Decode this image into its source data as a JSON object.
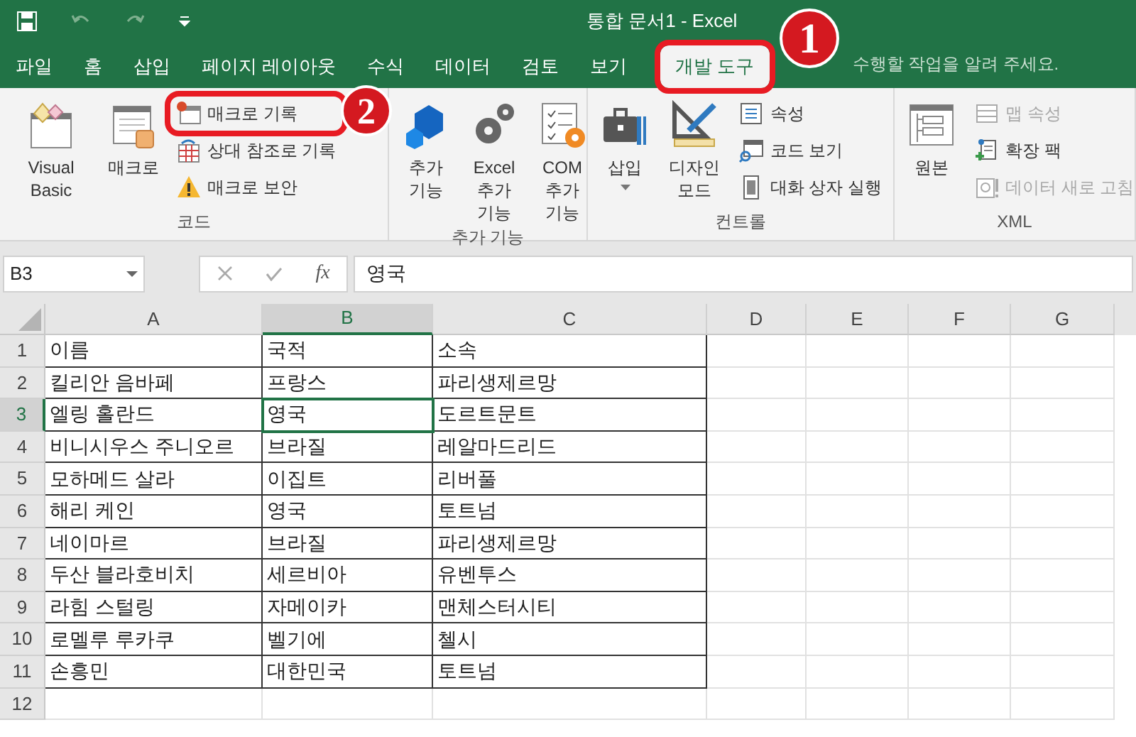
{
  "window": {
    "title": "통합 문서1 - Excel"
  },
  "tabs": [
    {
      "label": "파일",
      "selected": false,
      "highlighted": false
    },
    {
      "label": "홈",
      "selected": false,
      "highlighted": false
    },
    {
      "label": "삽입",
      "selected": false,
      "highlighted": false
    },
    {
      "label": "페이지 레이아웃",
      "selected": false,
      "highlighted": false
    },
    {
      "label": "수식",
      "selected": false,
      "highlighted": false
    },
    {
      "label": "데이터",
      "selected": false,
      "highlighted": false
    },
    {
      "label": "검토",
      "selected": false,
      "highlighted": false
    },
    {
      "label": "보기",
      "selected": false,
      "highlighted": false
    },
    {
      "label": "개발 도구",
      "selected": true,
      "highlighted": true
    }
  ],
  "tell_me": {
    "placeholder": "수행할 작업을 알려 주세요."
  },
  "ribbon_groups": [
    {
      "label": "코드",
      "items": [
        {
          "kind": "large",
          "label": "Visual Basic",
          "disabled": false,
          "highlighted": false,
          "dropdown": false
        },
        {
          "kind": "large",
          "label": "매크로",
          "disabled": false,
          "highlighted": false,
          "dropdown": false
        },
        {
          "kind": "small",
          "label": "매크로 기록",
          "disabled": false,
          "highlighted": true,
          "dropdown": false
        },
        {
          "kind": "small",
          "label": "상대 참조로 기록",
          "disabled": false,
          "highlighted": false,
          "dropdown": false
        },
        {
          "kind": "small",
          "label": "매크로 보안",
          "disabled": false,
          "highlighted": false,
          "dropdown": false
        }
      ]
    },
    {
      "label": "추가 기능",
      "items": [
        {
          "kind": "large",
          "label": "추가 기능",
          "disabled": false,
          "highlighted": false,
          "dropdown": false
        },
        {
          "kind": "large",
          "label": "Excel 추가 기능",
          "disabled": false,
          "highlighted": false,
          "dropdown": false
        },
        {
          "kind": "large",
          "label": "COM 추가 기능",
          "disabled": false,
          "highlighted": false,
          "dropdown": false
        }
      ]
    },
    {
      "label": "컨트롤",
      "items": [
        {
          "kind": "large",
          "label": "삽입",
          "disabled": false,
          "highlighted": false,
          "dropdown": true
        },
        {
          "kind": "large",
          "label": "디자인 모드",
          "disabled": false,
          "highlighted": false,
          "dropdown": false
        },
        {
          "kind": "small",
          "label": "속성",
          "disabled": false,
          "highlighted": false,
          "dropdown": false
        },
        {
          "kind": "small",
          "label": "코드 보기",
          "disabled": false,
          "highlighted": false,
          "dropdown": false
        },
        {
          "kind": "small",
          "label": "대화 상자 실행",
          "disabled": false,
          "highlighted": false,
          "dropdown": false
        }
      ]
    },
    {
      "label": "XML",
      "items": [
        {
          "kind": "large",
          "label": "원본",
          "disabled": false,
          "highlighted": false,
          "dropdown": false
        },
        {
          "kind": "small",
          "label": "맵 속성",
          "disabled": true,
          "highlighted": false,
          "dropdown": false
        },
        {
          "kind": "small",
          "label": "확장 팩",
          "disabled": false,
          "highlighted": false,
          "dropdown": false
        },
        {
          "kind": "small",
          "label": "데이터 새로 고침",
          "disabled": true,
          "highlighted": false,
          "dropdown": false
        }
      ]
    }
  ],
  "markers": [
    {
      "label": "1"
    },
    {
      "label": "2"
    }
  ],
  "formula_bar": {
    "name_box": "B3",
    "function_label": "fx",
    "value": "영국"
  },
  "sheet": {
    "columns": [
      {
        "label": "A",
        "selected": false
      },
      {
        "label": "B",
        "selected": true
      },
      {
        "label": "C",
        "selected": false
      },
      {
        "label": "D",
        "selected": false
      },
      {
        "label": "E",
        "selected": false
      },
      {
        "label": "F",
        "selected": false
      },
      {
        "label": "G",
        "selected": false
      }
    ],
    "rows": [
      {
        "label": "1",
        "selected": false,
        "cells": [
          "이름",
          "국적",
          "소속"
        ]
      },
      {
        "label": "2",
        "selected": false,
        "cells": [
          "킬리안 음바페",
          "프랑스",
          "파리생제르망"
        ]
      },
      {
        "label": "3",
        "selected": true,
        "cells": [
          "엘링 홀란드",
          "영국",
          "도르트문트"
        ]
      },
      {
        "label": "4",
        "selected": false,
        "cells": [
          "비니시우스 주니오르",
          "브라질",
          "레알마드리드"
        ]
      },
      {
        "label": "5",
        "selected": false,
        "cells": [
          "모하메드 살라",
          "이집트",
          "리버풀"
        ]
      },
      {
        "label": "6",
        "selected": false,
        "cells": [
          "해리 케인",
          "영국",
          "토트넘"
        ]
      },
      {
        "label": "7",
        "selected": false,
        "cells": [
          "네이마르",
          "브라질",
          "파리생제르망"
        ]
      },
      {
        "label": "8",
        "selected": false,
        "cells": [
          "두산 블라호비치",
          "세르비아",
          "유벤투스"
        ]
      },
      {
        "label": "9",
        "selected": false,
        "cells": [
          "라힘 스털링",
          "자메이카",
          "맨체스터시티"
        ]
      },
      {
        "label": "10",
        "selected": false,
        "cells": [
          "로멜루 루카쿠",
          "벨기에",
          "첼시"
        ]
      },
      {
        "label": "11",
        "selected": false,
        "cells": [
          "손흥민",
          "대한민국",
          "토트넘"
        ]
      },
      {
        "label": "12",
        "selected": false
      }
    ]
  }
}
